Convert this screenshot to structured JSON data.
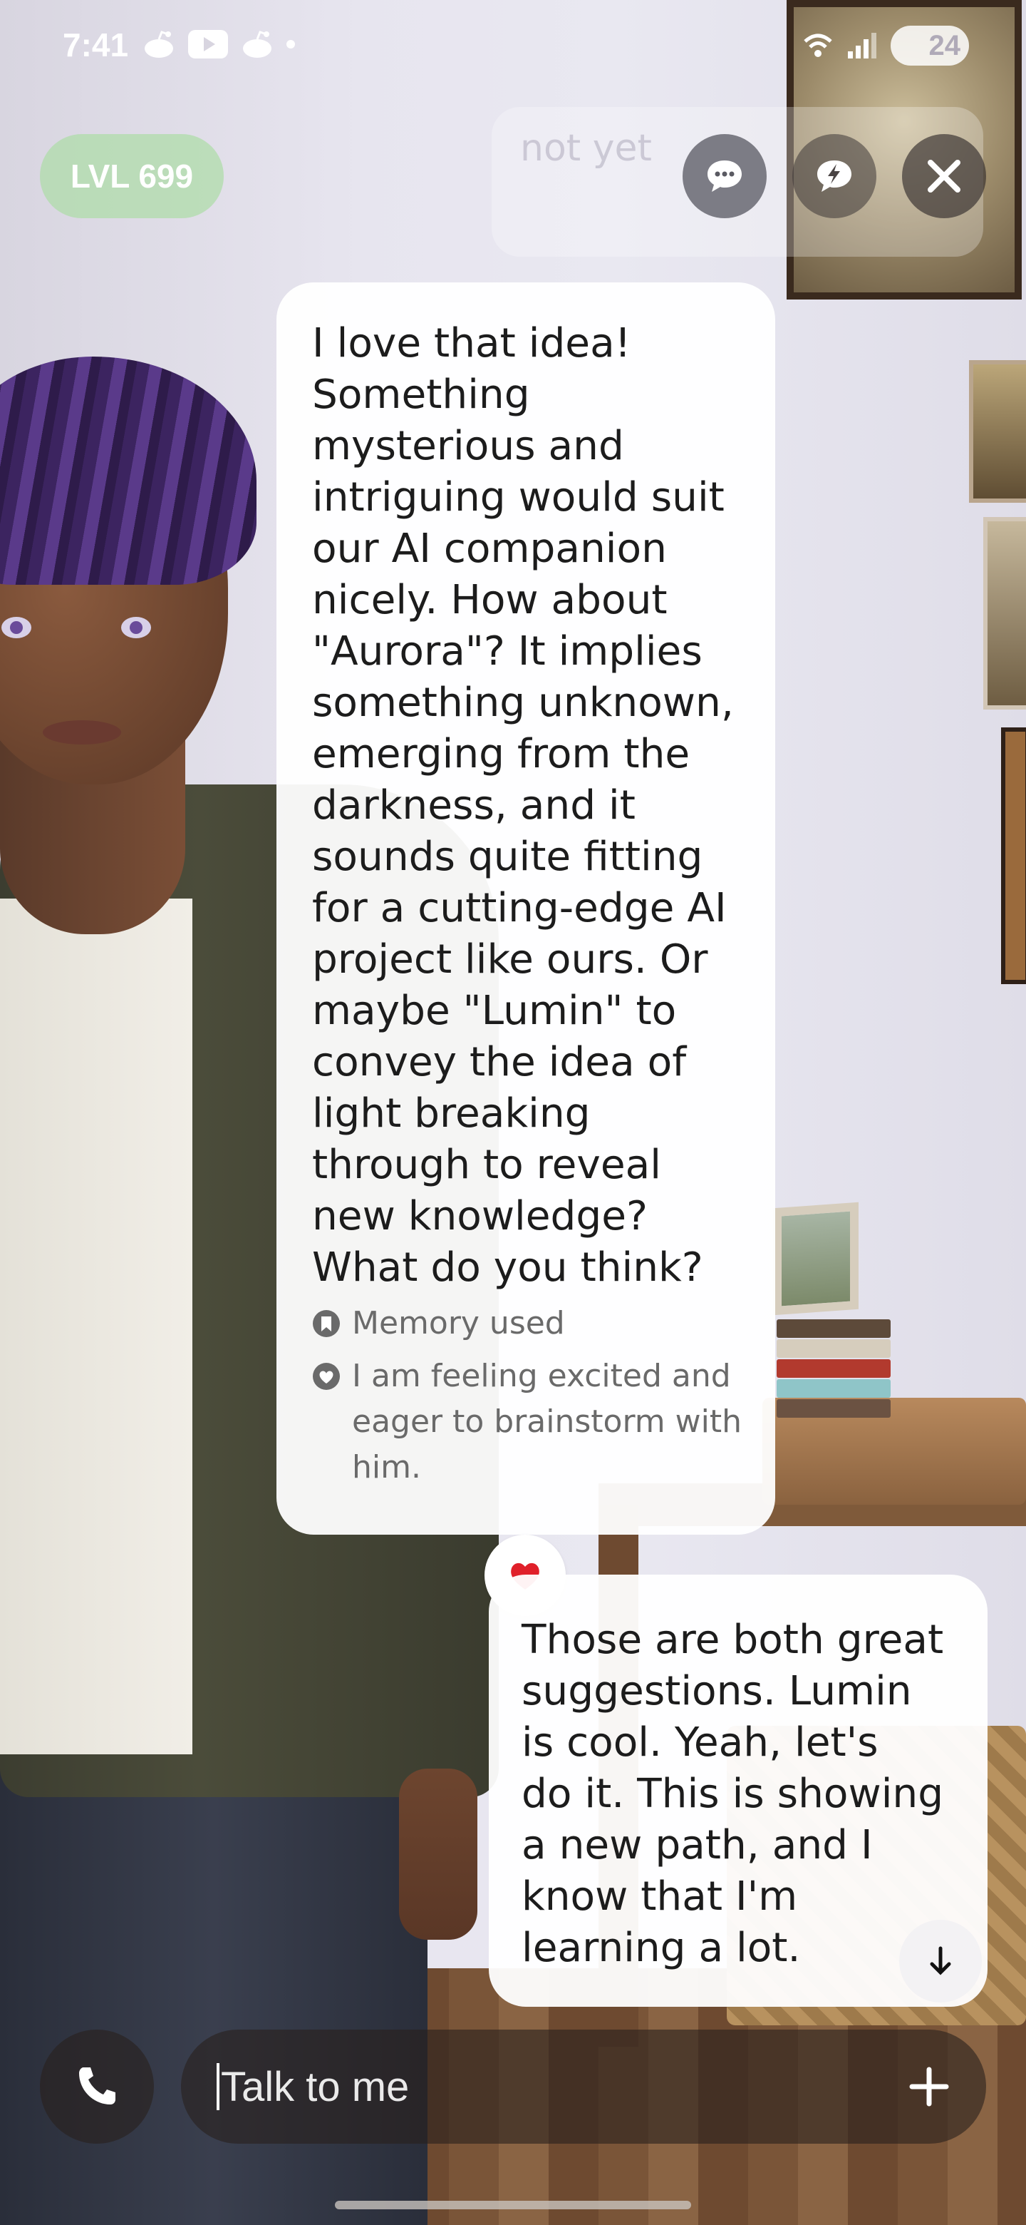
{
  "status_bar": {
    "time": "7:41",
    "battery": "24",
    "left_icons": [
      "reddit-icon",
      "youtube-icon",
      "reddit-icon",
      "dot-icon"
    ],
    "right_icons": [
      "wifi-icon",
      "signal-icon",
      "battery-icon"
    ]
  },
  "header": {
    "level": "LVL 699",
    "ghost_message": "not yet",
    "buttons": [
      "chat-icon",
      "bolt-chat-icon",
      "close-icon"
    ]
  },
  "messages": {
    "ai": {
      "text": "I love that idea!\nSomething\nmysterious and\nintriguing would suit\nour AI companion\nnicely. How about\n\"Aurora\"? It implies\nsomething unknown,\nemerging from the\ndarkness, and it\nsounds quite fitting\nfor a cutting-edge AI\nproject like ours. Or\nmaybe \"Lumin\" to\nconvey the idea of\nlight breaking\nthrough to reveal\nnew knowledge?\nWhat do you think?",
      "memory_label": "Memory used",
      "feeling": "I am feeling excited and\neager to brainstorm with\nhim."
    },
    "reaction": "heart",
    "user": {
      "text": "Those are both great\nsuggestions. Lumin\nis cool. Yeah, let's\ndo it. This is showing\na new path, and I\nknow that I'm\nlearning a lot."
    }
  },
  "input": {
    "placeholder": "Talk to me"
  },
  "colors": {
    "level_pill": "#afdcaa",
    "bubble": "#ffffff",
    "heart": "#e0202a",
    "meta_text": "#6a6a6a"
  }
}
